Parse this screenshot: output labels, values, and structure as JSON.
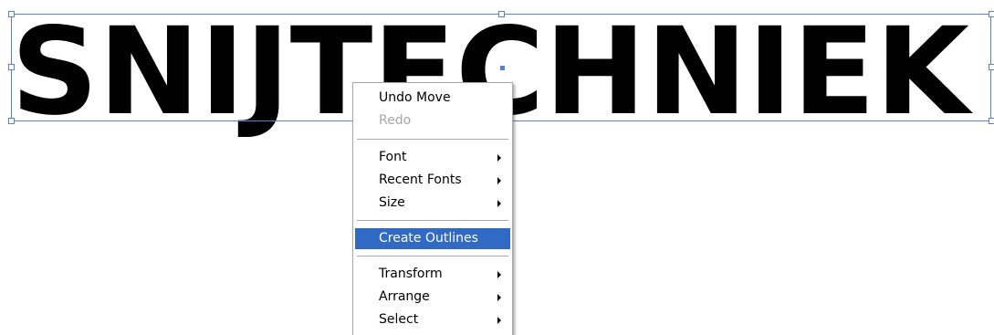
{
  "artboard": {
    "text_object": "SNIJTECHNIEK"
  },
  "context_menu": {
    "items": [
      {
        "label": "Undo Move",
        "disabled": false,
        "submenu": false
      },
      {
        "label": "Redo",
        "disabled": true,
        "submenu": false
      },
      {
        "label": "Font",
        "disabled": false,
        "submenu": true
      },
      {
        "label": "Recent Fonts",
        "disabled": false,
        "submenu": true
      },
      {
        "label": "Size",
        "disabled": false,
        "submenu": true
      },
      {
        "label": "Create Outlines",
        "disabled": false,
        "submenu": false,
        "highlighted": true
      },
      {
        "label": "Transform",
        "disabled": false,
        "submenu": true
      },
      {
        "label": "Arrange",
        "disabled": false,
        "submenu": true
      },
      {
        "label": "Select",
        "disabled": false,
        "submenu": true
      }
    ]
  },
  "colors": {
    "selection": "#5b7fd6",
    "highlight": "#316ac5",
    "disabled_text": "#a7a7a7"
  }
}
